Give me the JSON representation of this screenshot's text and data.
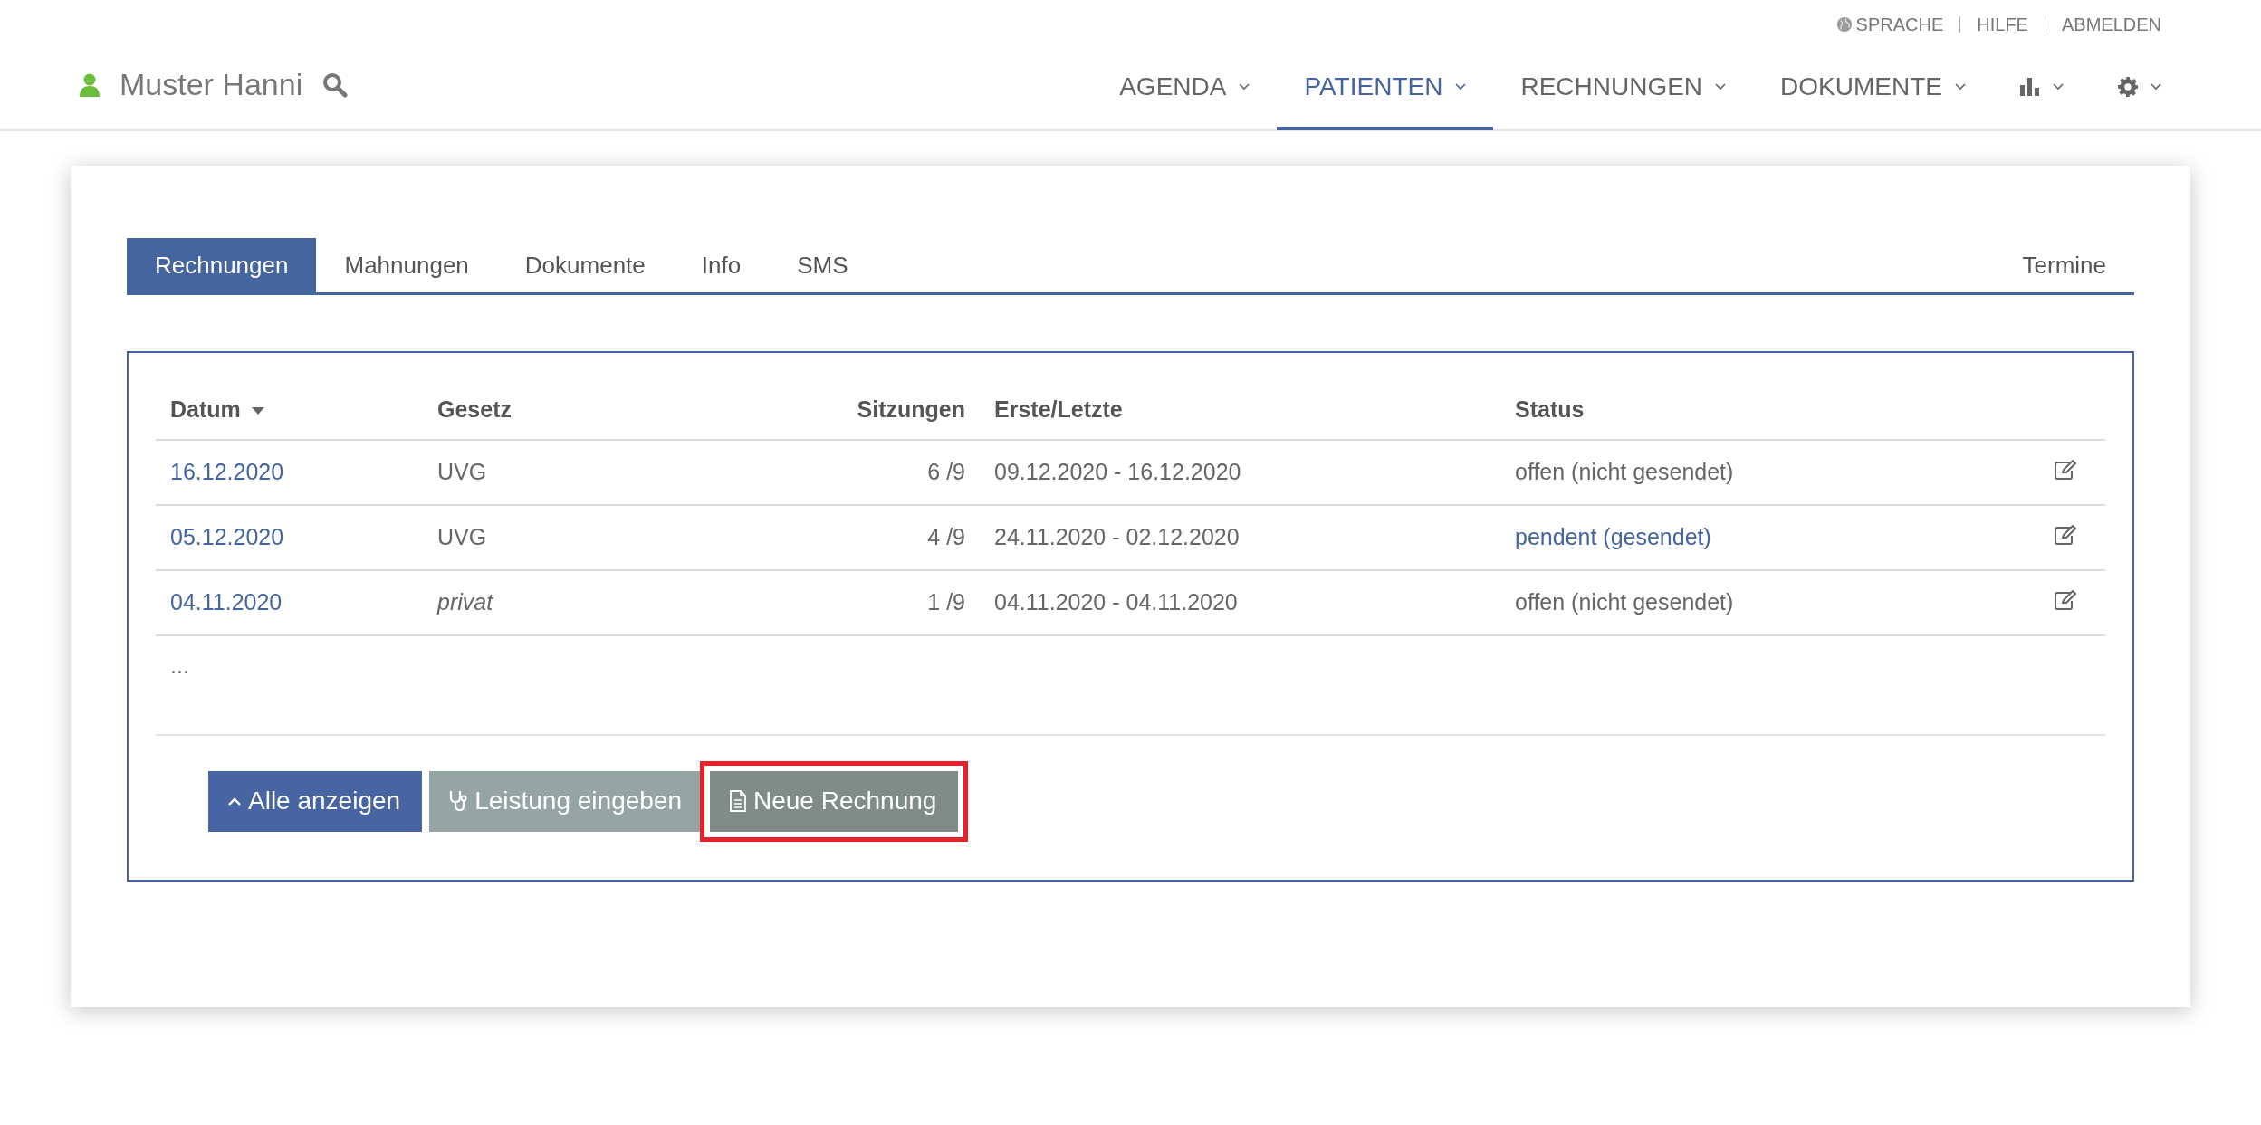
{
  "top_links": [
    {
      "label": "SPRACHE"
    },
    {
      "label": "HILFE"
    },
    {
      "label": "ABMELDEN"
    }
  ],
  "user": {
    "name": "Muster Hanni"
  },
  "nav": [
    {
      "kind": "text",
      "label": "AGENDA",
      "selected": false
    },
    {
      "kind": "text",
      "label": "PATIENTEN",
      "selected": true
    },
    {
      "kind": "text",
      "label": "RECHNUNGEN",
      "selected": false
    },
    {
      "kind": "text",
      "label": "DOKUMENTE",
      "selected": false
    },
    {
      "kind": "chart",
      "selected": false
    },
    {
      "kind": "gear",
      "selected": false
    }
  ],
  "tabs": [
    {
      "label": "Rechnungen",
      "selected": true
    },
    {
      "label": "Mahnungen",
      "selected": false
    },
    {
      "label": "Dokumente",
      "selected": false
    },
    {
      "label": "Info",
      "selected": false
    },
    {
      "label": "SMS",
      "selected": false
    },
    {
      "label": "Termine",
      "selected": false
    }
  ],
  "table": {
    "columns": [
      {
        "label": "Datum",
        "sorted": true
      },
      {
        "label": "Gesetz",
        "sorted": false
      },
      {
        "label": "Sitzungen",
        "sorted": false
      },
      {
        "label": "Erste/Letzte",
        "sorted": false
      },
      {
        "label": "Status",
        "sorted": false
      }
    ],
    "rows": [
      {
        "datum": "16.12.2020",
        "gesetz": "UVG",
        "private": false,
        "sitzungen": "6 /9",
        "erste_letzte": "09.12.2020 - 16.12.2020",
        "status": "offen (nicht gesendet)",
        "sent": false
      },
      {
        "datum": "05.12.2020",
        "gesetz": "UVG",
        "private": false,
        "sitzungen": "4 /9",
        "erste_letzte": "24.11.2020 - 02.12.2020",
        "status": "pendent (gesendet)",
        "sent": true
      },
      {
        "datum": "04.11.2020",
        "gesetz": "privat",
        "private": true,
        "sitzungen": "1 /9",
        "erste_letzte": "04.11.2020 - 04.11.2020",
        "status": "offen (nicht gesendet)",
        "sent": false
      }
    ],
    "more": "..."
  },
  "buttons": [
    {
      "label": "Alle anzeigen",
      "kind": "primary",
      "highlighted": false
    },
    {
      "label": "Leistung eingeben",
      "kind": "light",
      "highlighted": false
    },
    {
      "label": "Neue Rechnung",
      "kind": "dark",
      "highlighted": true
    }
  ]
}
